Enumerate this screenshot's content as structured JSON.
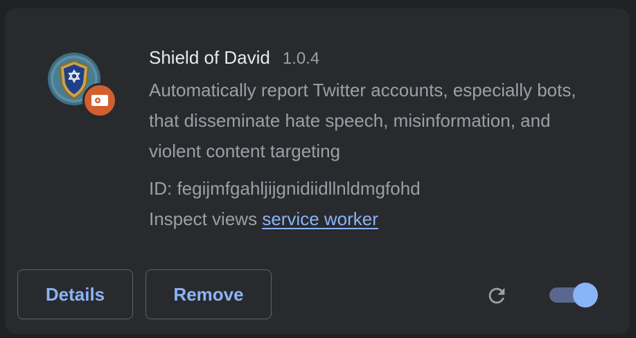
{
  "extension": {
    "name": "Shield of David",
    "version": "1.0.4",
    "description": "Automatically report Twitter accounts, especially bots, that disseminate hate speech, misinformation, and violent content targeting",
    "id_text": "ID: fegijmfgahljijgnidiidllnldmgfohd",
    "inspect_label": "Inspect views",
    "inspect_link": "service worker",
    "icon": "shield-star-of-david-icon",
    "badge_icon": "developer-mode-badge-icon"
  },
  "actions": {
    "details_label": "Details",
    "remove_label": "Remove",
    "reload_icon": "reload-icon",
    "enabled": true
  },
  "colors": {
    "background": "#202124",
    "card": "#292a2d",
    "text_primary": "#e8eaed",
    "text_secondary": "#9aa0a6",
    "accent": "#8ab4f8",
    "badge": "#d35f2e"
  }
}
